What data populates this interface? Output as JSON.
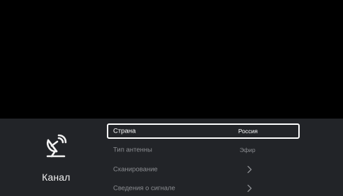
{
  "side": {
    "title": "Канал",
    "icon": "satellite-dish-icon"
  },
  "menu": {
    "items": [
      {
        "label": "Страна",
        "value": "Россия",
        "selected": true
      },
      {
        "label": "Тип антенны",
        "value": "Эфир",
        "selected": false
      },
      {
        "label": "Сканирование",
        "value": "",
        "icon": "chevron-right-icon",
        "selected": false
      },
      {
        "label": "Сведения о сигнале",
        "value": "",
        "icon": "chevron-right-icon",
        "selected": false
      }
    ]
  },
  "colors": {
    "background": "#000000",
    "panel": "#222428",
    "text_active": "#ffffff",
    "text_inactive": "#8b8d91"
  }
}
